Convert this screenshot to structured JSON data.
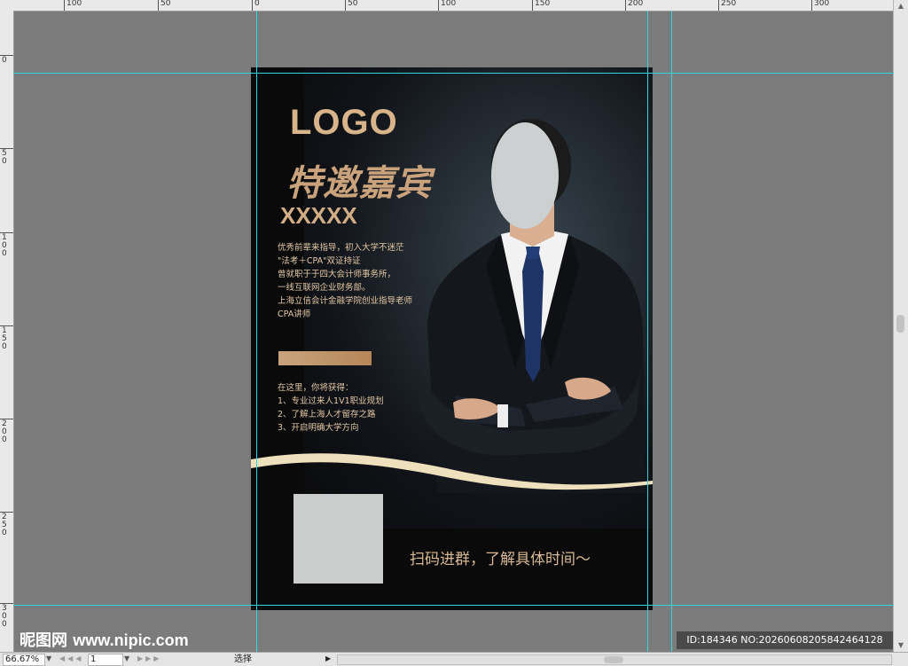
{
  "rulers": {
    "top_labels": [
      "100",
      "50",
      "0",
      "50",
      "100",
      "150",
      "200",
      "250",
      "300"
    ],
    "left_labels": [
      "0",
      "50",
      "100",
      "150",
      "200",
      "250",
      "300"
    ]
  },
  "poster": {
    "logo": "LOGO",
    "headline": "特邀嘉宾",
    "name": "XXXXX",
    "bio_lines": [
      "优秀前辈来指导，初入大学不迷茫",
      "\"法考＋CPA\"双证持证",
      "曾就职于于四大会计师事务所，",
      "一线互联网企业财务部。",
      "上海立信会计金融学院创业指导老师",
      "CPA讲师"
    ],
    "benefits_lines": [
      "在这里，你将获得：",
      "1、专业过来人1V1职业规划",
      "2、了解上海人才留存之路",
      "3、开启明确大学方向"
    ],
    "scan_text": "扫码进群，了解具体时间～"
  },
  "watermark": {
    "brand": "昵图网",
    "site": "www.nipic.com",
    "id_text": "ID:184346 NO:20260608205842464128"
  },
  "statusbar": {
    "zoom": "66.67%",
    "page": "1",
    "tool_label": "选择"
  },
  "colors": {
    "guide": "#2fd8e6",
    "gold": "#d8b48a",
    "canvas": "#7b7b7b"
  }
}
